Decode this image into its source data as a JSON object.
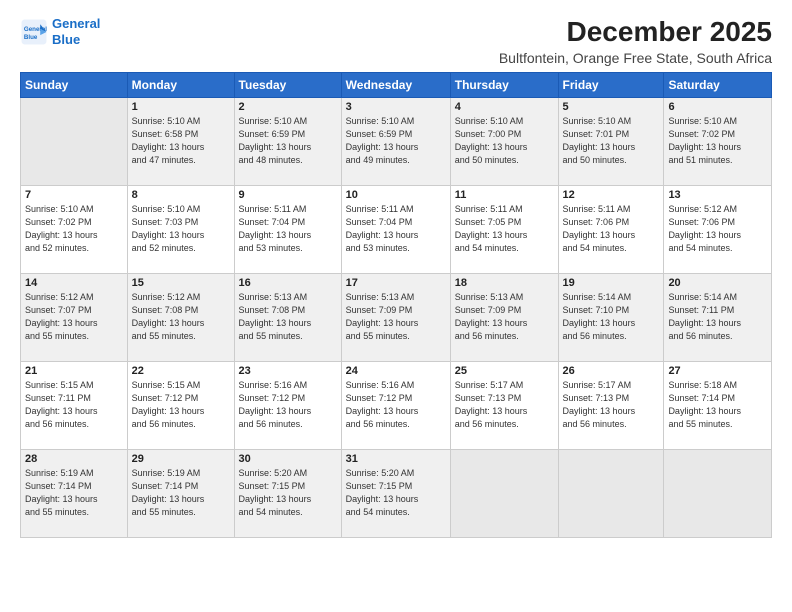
{
  "logo": {
    "line1": "General",
    "line2": "Blue"
  },
  "title": "December 2025",
  "subtitle": "Bultfontein, Orange Free State, South Africa",
  "weekdays": [
    "Sunday",
    "Monday",
    "Tuesday",
    "Wednesday",
    "Thursday",
    "Friday",
    "Saturday"
  ],
  "weeks": [
    [
      {
        "day": "",
        "info": ""
      },
      {
        "day": "1",
        "info": "Sunrise: 5:10 AM\nSunset: 6:58 PM\nDaylight: 13 hours\nand 47 minutes."
      },
      {
        "day": "2",
        "info": "Sunrise: 5:10 AM\nSunset: 6:59 PM\nDaylight: 13 hours\nand 48 minutes."
      },
      {
        "day": "3",
        "info": "Sunrise: 5:10 AM\nSunset: 6:59 PM\nDaylight: 13 hours\nand 49 minutes."
      },
      {
        "day": "4",
        "info": "Sunrise: 5:10 AM\nSunset: 7:00 PM\nDaylight: 13 hours\nand 50 minutes."
      },
      {
        "day": "5",
        "info": "Sunrise: 5:10 AM\nSunset: 7:01 PM\nDaylight: 13 hours\nand 50 minutes."
      },
      {
        "day": "6",
        "info": "Sunrise: 5:10 AM\nSunset: 7:02 PM\nDaylight: 13 hours\nand 51 minutes."
      }
    ],
    [
      {
        "day": "7",
        "info": "Sunrise: 5:10 AM\nSunset: 7:02 PM\nDaylight: 13 hours\nand 52 minutes."
      },
      {
        "day": "8",
        "info": "Sunrise: 5:10 AM\nSunset: 7:03 PM\nDaylight: 13 hours\nand 52 minutes."
      },
      {
        "day": "9",
        "info": "Sunrise: 5:11 AM\nSunset: 7:04 PM\nDaylight: 13 hours\nand 53 minutes."
      },
      {
        "day": "10",
        "info": "Sunrise: 5:11 AM\nSunset: 7:04 PM\nDaylight: 13 hours\nand 53 minutes."
      },
      {
        "day": "11",
        "info": "Sunrise: 5:11 AM\nSunset: 7:05 PM\nDaylight: 13 hours\nand 54 minutes."
      },
      {
        "day": "12",
        "info": "Sunrise: 5:11 AM\nSunset: 7:06 PM\nDaylight: 13 hours\nand 54 minutes."
      },
      {
        "day": "13",
        "info": "Sunrise: 5:12 AM\nSunset: 7:06 PM\nDaylight: 13 hours\nand 54 minutes."
      }
    ],
    [
      {
        "day": "14",
        "info": "Sunrise: 5:12 AM\nSunset: 7:07 PM\nDaylight: 13 hours\nand 55 minutes."
      },
      {
        "day": "15",
        "info": "Sunrise: 5:12 AM\nSunset: 7:08 PM\nDaylight: 13 hours\nand 55 minutes."
      },
      {
        "day": "16",
        "info": "Sunrise: 5:13 AM\nSunset: 7:08 PM\nDaylight: 13 hours\nand 55 minutes."
      },
      {
        "day": "17",
        "info": "Sunrise: 5:13 AM\nSunset: 7:09 PM\nDaylight: 13 hours\nand 55 minutes."
      },
      {
        "day": "18",
        "info": "Sunrise: 5:13 AM\nSunset: 7:09 PM\nDaylight: 13 hours\nand 56 minutes."
      },
      {
        "day": "19",
        "info": "Sunrise: 5:14 AM\nSunset: 7:10 PM\nDaylight: 13 hours\nand 56 minutes."
      },
      {
        "day": "20",
        "info": "Sunrise: 5:14 AM\nSunset: 7:11 PM\nDaylight: 13 hours\nand 56 minutes."
      }
    ],
    [
      {
        "day": "21",
        "info": "Sunrise: 5:15 AM\nSunset: 7:11 PM\nDaylight: 13 hours\nand 56 minutes."
      },
      {
        "day": "22",
        "info": "Sunrise: 5:15 AM\nSunset: 7:12 PM\nDaylight: 13 hours\nand 56 minutes."
      },
      {
        "day": "23",
        "info": "Sunrise: 5:16 AM\nSunset: 7:12 PM\nDaylight: 13 hours\nand 56 minutes."
      },
      {
        "day": "24",
        "info": "Sunrise: 5:16 AM\nSunset: 7:12 PM\nDaylight: 13 hours\nand 56 minutes."
      },
      {
        "day": "25",
        "info": "Sunrise: 5:17 AM\nSunset: 7:13 PM\nDaylight: 13 hours\nand 56 minutes."
      },
      {
        "day": "26",
        "info": "Sunrise: 5:17 AM\nSunset: 7:13 PM\nDaylight: 13 hours\nand 56 minutes."
      },
      {
        "day": "27",
        "info": "Sunrise: 5:18 AM\nSunset: 7:14 PM\nDaylight: 13 hours\nand 55 minutes."
      }
    ],
    [
      {
        "day": "28",
        "info": "Sunrise: 5:19 AM\nSunset: 7:14 PM\nDaylight: 13 hours\nand 55 minutes."
      },
      {
        "day": "29",
        "info": "Sunrise: 5:19 AM\nSunset: 7:14 PM\nDaylight: 13 hours\nand 55 minutes."
      },
      {
        "day": "30",
        "info": "Sunrise: 5:20 AM\nSunset: 7:15 PM\nDaylight: 13 hours\nand 54 minutes."
      },
      {
        "day": "31",
        "info": "Sunrise: 5:20 AM\nSunset: 7:15 PM\nDaylight: 13 hours\nand 54 minutes."
      },
      {
        "day": "",
        "info": ""
      },
      {
        "day": "",
        "info": ""
      },
      {
        "day": "",
        "info": ""
      }
    ]
  ]
}
